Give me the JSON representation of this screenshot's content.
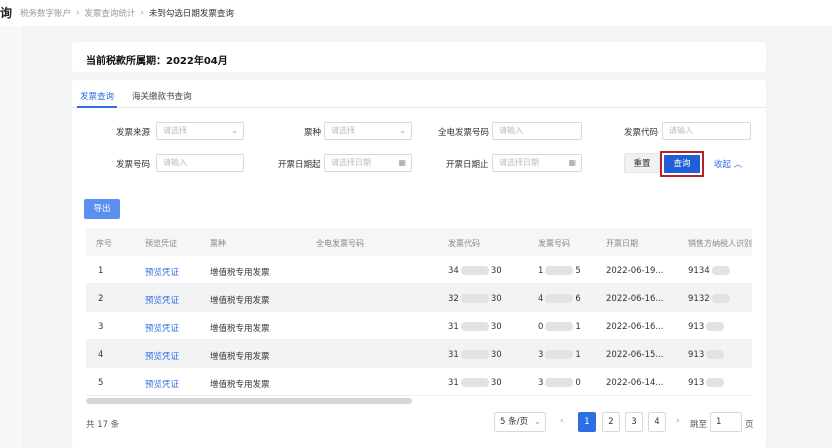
{
  "header": {
    "edge_char": "询",
    "breadcrumb": [
      "税务数字账户",
      "发票查询统计",
      "未到勾选日期发票查询"
    ]
  },
  "period": {
    "label": "当前税款所属期：",
    "value": "2022年04月"
  },
  "tabs": [
    "发票查询",
    "海关缴款书查询"
  ],
  "filters": {
    "source_label": "发票来源",
    "source_placeholder": "请选择",
    "type_label": "票种",
    "type_placeholder": "请选择",
    "full_number_label": "全电发票号码",
    "full_number_placeholder": "请输入",
    "code_label": "发票代码",
    "code_placeholder": "请输入",
    "number_label": "发票号码",
    "number_placeholder": "请输入",
    "date_from_label": "开票日期起",
    "date_from_placeholder": "请选择日期",
    "date_to_label": "开票日期止",
    "date_to_placeholder": "请选择日期"
  },
  "actions": {
    "reset": "重置",
    "query": "查询",
    "collapse": "收起",
    "export": "导出"
  },
  "table": {
    "columns": [
      "序号",
      "预览凭证",
      "票种",
      "全电发票号码",
      "发票代码",
      "发票号码",
      "开票日期",
      "销售方纳税人识别"
    ],
    "rows": [
      {
        "index": "1",
        "preview": "预览凭证",
        "type": "增值税专用发票",
        "code_start": "34",
        "code_end": "30",
        "num_start": "1",
        "num_end": "5",
        "date": "2022-06-19...",
        "seller": "9134"
      },
      {
        "index": "2",
        "preview": "预览凭证",
        "type": "增值税专用发票",
        "code_start": "32",
        "code_end": "30",
        "num_start": "4",
        "num_end": "6",
        "date": "2022-06-16...",
        "seller": "9132"
      },
      {
        "index": "3",
        "preview": "预览凭证",
        "type": "增值税专用发票",
        "code_start": "31",
        "code_end": "30",
        "num_start": "0",
        "num_end": "1",
        "date": "2022-06-16...",
        "seller": "913"
      },
      {
        "index": "4",
        "preview": "预览凭证",
        "type": "增值税专用发票",
        "code_start": "31",
        "code_end": "30",
        "num_start": "3",
        "num_end": "1",
        "date": "2022-06-15...",
        "seller": "913"
      },
      {
        "index": "5",
        "preview": "预览凭证",
        "type": "增值税专用发票",
        "code_start": "31",
        "code_end": "30",
        "num_start": "3",
        "num_end": "0",
        "date": "2022-06-14...",
        "seller": "913"
      }
    ]
  },
  "pagination": {
    "total": "共 17 条",
    "page_size": "5 条/页",
    "pages": [
      "1",
      "2",
      "3",
      "4"
    ],
    "jump_label": "跳至",
    "jump_value": "1",
    "page_unit": "页"
  }
}
